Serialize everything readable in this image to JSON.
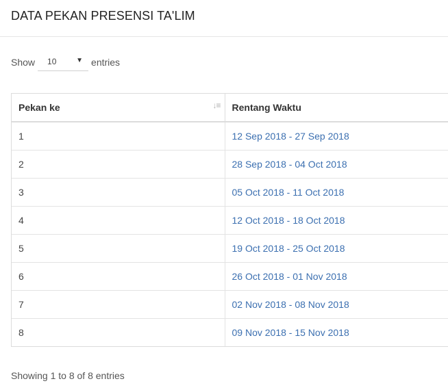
{
  "header": {
    "title": "DATA PEKAN PRESENSI TA'LIM"
  },
  "length_control": {
    "show_label": "Show",
    "selected": "10",
    "entries_label": "entries"
  },
  "table": {
    "columns": [
      "Pekan ke",
      "Rentang Waktu"
    ],
    "rows": [
      {
        "week": "1",
        "range": "12 Sep 2018 - 27 Sep 2018"
      },
      {
        "week": "2",
        "range": "28 Sep 2018 - 04 Oct 2018"
      },
      {
        "week": "3",
        "range": "05 Oct 2018 - 11 Oct 2018"
      },
      {
        "week": "4",
        "range": "12 Oct 2018 - 18 Oct 2018"
      },
      {
        "week": "5",
        "range": "19 Oct 2018 - 25 Oct 2018"
      },
      {
        "week": "6",
        "range": "26 Oct 2018 - 01 Nov 2018"
      },
      {
        "week": "7",
        "range": "02 Nov 2018 - 08 Nov 2018"
      },
      {
        "week": "8",
        "range": "09 Nov 2018 - 15 Nov 2018"
      }
    ]
  },
  "info": {
    "text": "Showing 1 to 8 of 8 entries"
  },
  "colors": {
    "link": "#3b6fb0",
    "border": "#dcdcdc"
  },
  "icons": {
    "sort": "sort-ascending-icon",
    "caret": "caret-down-icon"
  }
}
